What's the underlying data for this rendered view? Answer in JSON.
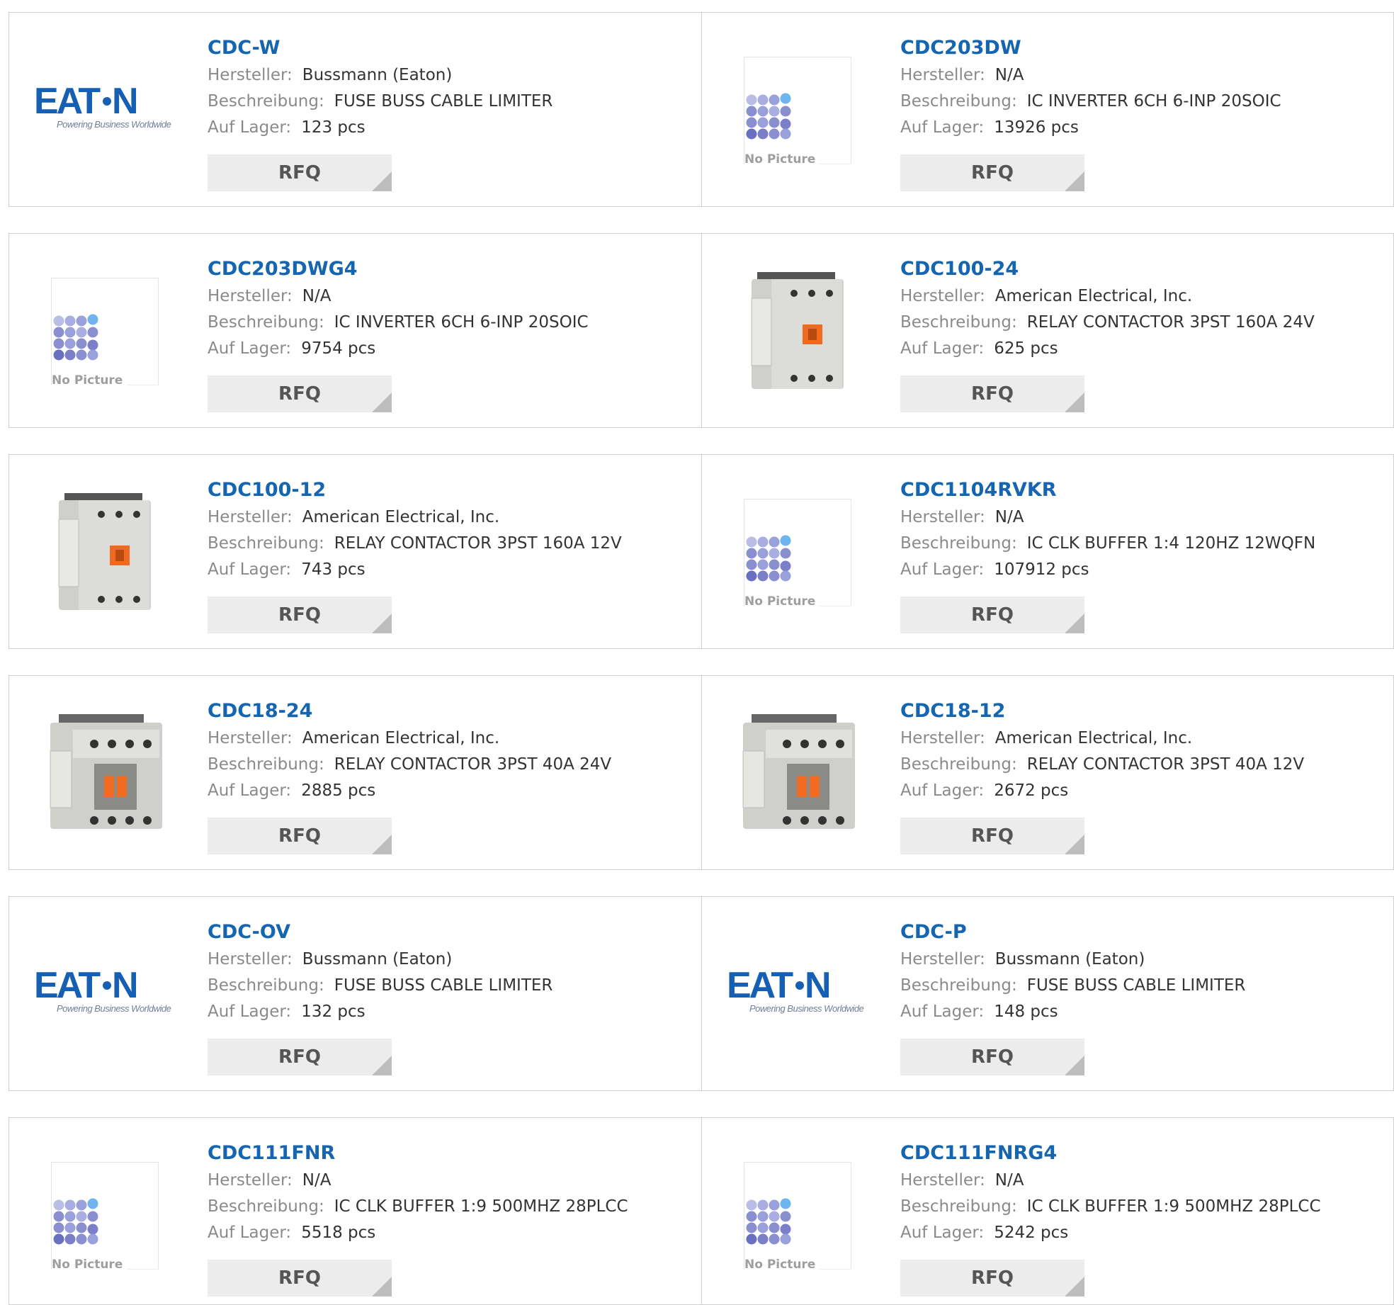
{
  "labels": {
    "manufacturer": "Hersteller:",
    "description": "Beschreibung:",
    "stock": "Auf Lager:",
    "rfq": "RFQ",
    "no_picture": "No Picture",
    "eaton_tagline": "Powering Business Worldwide"
  },
  "products": [
    {
      "pn": "CDC-W",
      "manufacturer": "Bussmann (Eaton)",
      "description": "FUSE BUSS CABLE LIMITER",
      "stock": "123 pcs",
      "image": "eaton-logo"
    },
    {
      "pn": "CDC203DW",
      "manufacturer": "N/A",
      "description": "IC INVERTER 6CH 6-INP 20SOIC",
      "stock": "13926 pcs",
      "image": "no-picture"
    },
    {
      "pn": "CDC203DWG4",
      "manufacturer": "N/A",
      "description": "IC INVERTER 6CH 6-INP 20SOIC",
      "stock": "9754 pcs",
      "image": "no-picture"
    },
    {
      "pn": "CDC100-24",
      "manufacturer": "American Electrical, Inc.",
      "description": "RELAY CONTACTOR 3PST 160A 24V",
      "stock": "625 pcs",
      "image": "contactor-large"
    },
    {
      "pn": "CDC100-12",
      "manufacturer": "American Electrical, Inc.",
      "description": "RELAY CONTACTOR 3PST 160A 12V",
      "stock": "743 pcs",
      "image": "contactor-large"
    },
    {
      "pn": "CDC1104RVKR",
      "manufacturer": "N/A",
      "description": "IC CLK BUFFER 1:4 120HZ 12WQFN",
      "stock": "107912 pcs",
      "image": "no-picture"
    },
    {
      "pn": "CDC18-24",
      "manufacturer": "American Electrical, Inc.",
      "description": "RELAY CONTACTOR 3PST 40A 24V",
      "stock": "2885 pcs",
      "image": "contactor-small"
    },
    {
      "pn": "CDC18-12",
      "manufacturer": "American Electrical, Inc.",
      "description": "RELAY CONTACTOR 3PST 40A 12V",
      "stock": "2672 pcs",
      "image": "contactor-small"
    },
    {
      "pn": "CDC-OV",
      "manufacturer": "Bussmann (Eaton)",
      "description": "FUSE BUSS CABLE LIMITER",
      "stock": "132 pcs",
      "image": "eaton-logo"
    },
    {
      "pn": "CDC-P",
      "manufacturer": "Bussmann (Eaton)",
      "description": "FUSE BUSS CABLE LIMITER",
      "stock": "148 pcs",
      "image": "eaton-logo"
    },
    {
      "pn": "CDC111FNR",
      "manufacturer": "N/A",
      "description": "IC CLK BUFFER 1:9 500MHZ 28PLCC",
      "stock": "5518 pcs",
      "image": "no-picture"
    },
    {
      "pn": "CDC111FNRG4",
      "manufacturer": "N/A",
      "description": "IC CLK BUFFER 1:9 500MHZ 28PLCC",
      "stock": "5242 pcs",
      "image": "no-picture"
    }
  ],
  "colors": {
    "part_number": "#1565b0",
    "label": "#8a8a8a",
    "eaton_blue": "#1560b5",
    "nopic_dots": "#8a8fd0"
  }
}
